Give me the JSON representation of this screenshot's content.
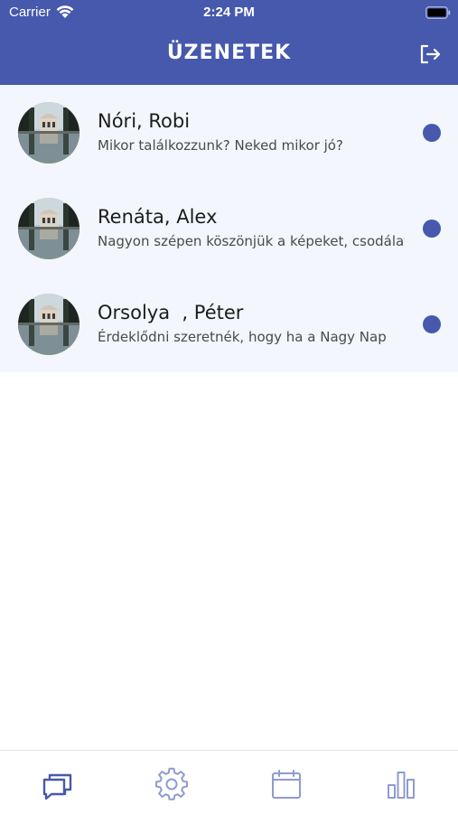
{
  "status_bar": {
    "carrier": "Carrier",
    "time": "2:24 PM"
  },
  "header": {
    "title": "ÜZENETEK",
    "action_icon": "logout-icon"
  },
  "conversations": [
    {
      "name": "Nóri, Robi",
      "preview": "Mikor találkozzunk? Neked mikor jó?",
      "unread": true
    },
    {
      "name": "Renáta, Alex",
      "preview": "Nagyon szépen köszönjük a képeket, csodálatosak lettek!",
      "unread": true
    },
    {
      "name": "Orsolya  , Péter",
      "preview": "Érdeklődni szeretnék, hogy ha a Nagy Nap",
      "unread": true
    }
  ],
  "tab_bar": {
    "tabs": [
      {
        "icon": "chat-bubbles-icon",
        "active": true
      },
      {
        "icon": "gear-icon",
        "active": false
      },
      {
        "icon": "calendar-icon",
        "active": false
      },
      {
        "icon": "bar-chart-icon",
        "active": false
      }
    ]
  },
  "colors": {
    "primary": "#4659ac",
    "list_background": "#f3f6fd",
    "inactive_icon": "#8f9bd0"
  }
}
